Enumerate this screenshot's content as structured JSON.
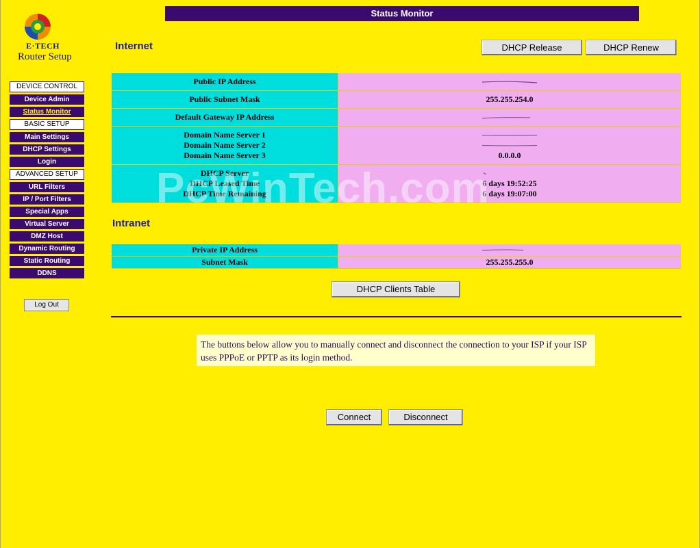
{
  "logo": {
    "brand": "E·TECH",
    "subtitle": "Router Setup"
  },
  "title": "Status Monitor",
  "menu": [
    {
      "type": "header",
      "label": "DEVICE CONTROL"
    },
    {
      "type": "item",
      "label": "Device Admin"
    },
    {
      "type": "item",
      "label": "Status Monitor",
      "active": true
    },
    {
      "type": "header",
      "label": "BASIC SETUP"
    },
    {
      "type": "item",
      "label": "Main Settings"
    },
    {
      "type": "item",
      "label": "DHCP Settings"
    },
    {
      "type": "item",
      "label": "Login"
    },
    {
      "type": "header",
      "label": "ADVANCED SETUP"
    },
    {
      "type": "item",
      "label": "URL Filters"
    },
    {
      "type": "item",
      "label": "IP / Port Filters"
    },
    {
      "type": "item",
      "label": "Special Apps"
    },
    {
      "type": "item",
      "label": "Virtual Server"
    },
    {
      "type": "item",
      "label": "DMZ Host"
    },
    {
      "type": "item",
      "label": "Dynamic Routing"
    },
    {
      "type": "item",
      "label": "Static Routing"
    },
    {
      "type": "item",
      "label": "DDNS"
    }
  ],
  "logout_label": "Log Out",
  "internet": {
    "title": "Internet",
    "dhcp_release_label": "DHCP Release",
    "dhcp_renew_label": "DHCP Renew",
    "public_ip_label": "Public IP Address",
    "public_subnet_label": "Public Subnet Mask",
    "public_subnet_value": "255.255.254.0",
    "gateway_label": "Default Gateway IP Address",
    "dns1_label": "Domain Name Server 1",
    "dns2_label": "Domain Name Server 2",
    "dns3_label": "Domain Name Server 3",
    "dns3_value": "0.0.0.0",
    "dhcp_server_label": "DHCP Server",
    "dhcp_leased_label": "DHCP Leased Time",
    "dhcp_leased_value": "6 days 19:52:25",
    "dhcp_remaining_label": "DHCP Time Remaining",
    "dhcp_remaining_value": "6 days 19:07:00"
  },
  "watermark": "PcWinTech.com",
  "intranet": {
    "title": "Intranet",
    "private_ip_label": "Private IP Address",
    "subnet_label": "Subnet Mask",
    "subnet_value": "255.255.255.0",
    "dhcp_clients_label": "DHCP Clients Table"
  },
  "note": "The buttons below allow you to manually connect and disconnect the connection to your ISP if your ISP uses PPPoE or PPTP as its login method.",
  "connect_label": "Connect",
  "disconnect_label": "Disconnect",
  "colors": {
    "background": "#ffee00",
    "nav": "#3a0a6e",
    "label_cell": "#00dddd",
    "value_cell": "#f0aef0",
    "note_bg": "#ffffcc"
  }
}
